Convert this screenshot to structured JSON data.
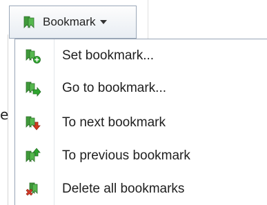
{
  "toolbar": {
    "bookmark_button_label": "Bookmark",
    "bookmark_button_icon": "bookmark-icon"
  },
  "background": {
    "partial_text": "e"
  },
  "menu": {
    "items": [
      {
        "label": "Set bookmark...",
        "icon": "bookmark-add-icon"
      },
      {
        "label": "Go to bookmark...",
        "icon": "bookmark-goto-icon"
      },
      {
        "label": "To next bookmark",
        "icon": "bookmark-next-icon"
      },
      {
        "label": "To previous bookmark",
        "icon": "bookmark-previous-icon"
      },
      {
        "label": "Delete all bookmarks",
        "icon": "bookmark-delete-icon"
      }
    ]
  },
  "colors": {
    "bookmark_green": "#3f9a3a",
    "add_green": "#2fa52f",
    "arrow_red": "#d43a1e",
    "delete_red": "#d23a2a",
    "border": "#9aa7b8"
  }
}
